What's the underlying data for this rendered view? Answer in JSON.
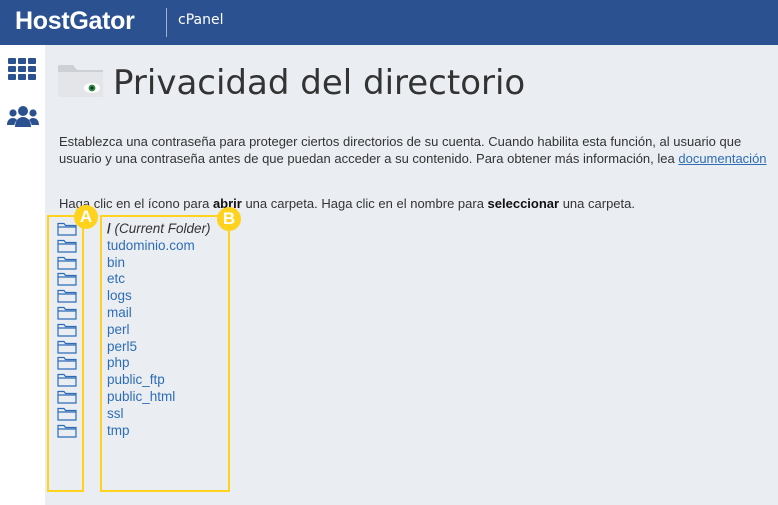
{
  "header": {
    "logo": "HostGator",
    "product": "cPanel"
  },
  "sidebar": {
    "items": [
      {
        "icon": "grid-icon"
      },
      {
        "icon": "users-icon"
      }
    ]
  },
  "page": {
    "title": "Privacidad del directorio",
    "description_line1": "Establezca una contraseña para proteger ciertos directorios de su cuenta. Cuando habilita esta función, al usuario que",
    "description_line2_text": "usuario y una contraseña antes de que puedan acceder a su contenido. Para obtener más información, lea ",
    "description_link": "documentación",
    "instruction": {
      "part1": "Haga clic en el ícono para ",
      "bold1": "abrir",
      "part2": " una carpeta. Haga clic en el nombre para ",
      "bold2": "seleccionar",
      "part3": " una carpeta."
    }
  },
  "folders": {
    "current": {
      "slash": "/",
      "label": "(Current Folder)"
    },
    "items": [
      "tudominio.com",
      "bin",
      "etc",
      "logs",
      "mail",
      "perl",
      "perl5",
      "php",
      "public_ftp",
      "public_html",
      "ssl",
      "tmp"
    ]
  },
  "annotations": {
    "a": "A",
    "b": "B"
  },
  "colors": {
    "header": "#2b5191",
    "link": "#2e6db6",
    "highlight": "#ffd21e",
    "background": "#eaedf2"
  }
}
